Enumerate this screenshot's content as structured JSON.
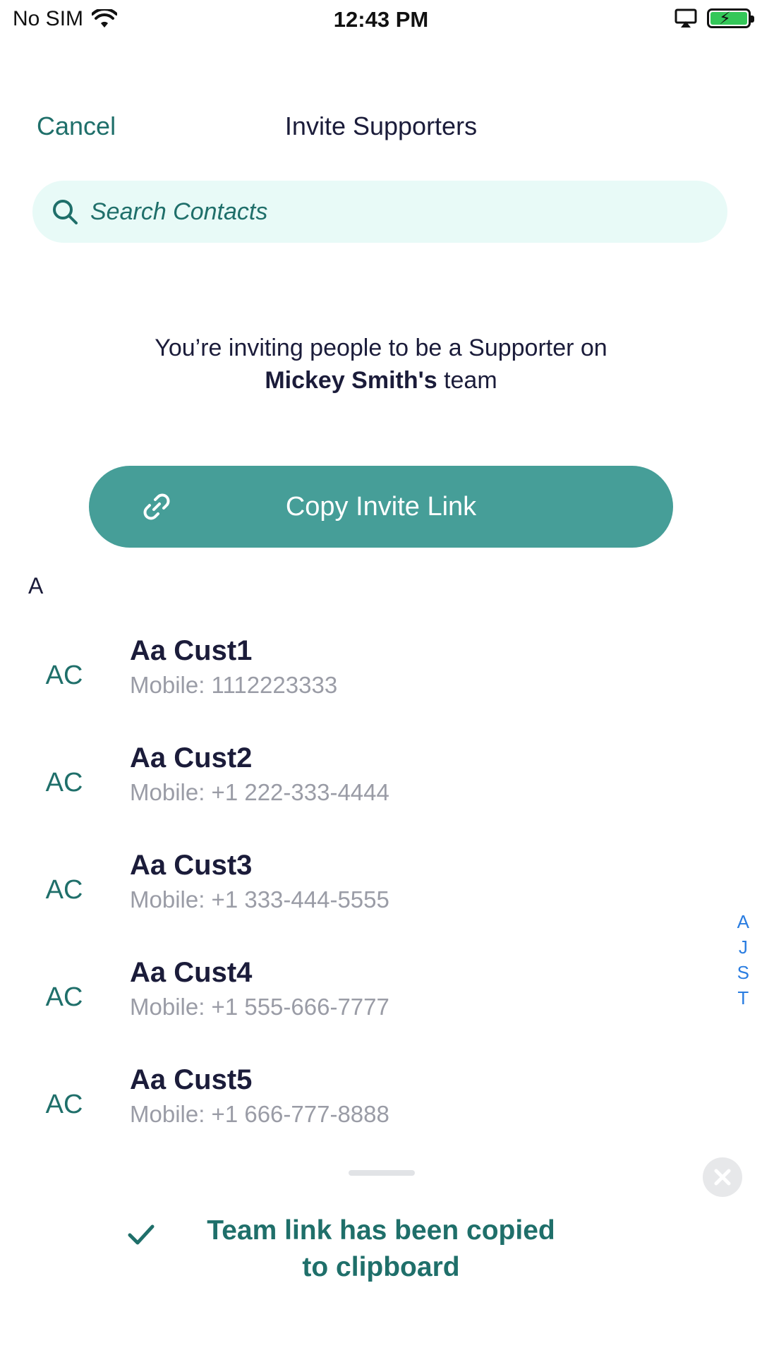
{
  "status_bar": {
    "carrier": "No SIM",
    "time": "12:43 PM",
    "icons": [
      "wifi-icon",
      "airplay-icon",
      "battery-charging-icon"
    ]
  },
  "nav": {
    "cancel_label": "Cancel",
    "title": "Invite Supporters"
  },
  "search": {
    "placeholder": "Search Contacts",
    "value": ""
  },
  "info": {
    "line1": "You’re inviting people to be a Supporter on",
    "name": "Mickey Smith's",
    "suffix": " team"
  },
  "copy_button": {
    "label": "Copy Invite Link",
    "icon": "link-icon"
  },
  "section": {
    "letter": "A"
  },
  "contacts": [
    {
      "initials": "AC",
      "name": "Aa Cust1",
      "phone": "Mobile: 1112223333"
    },
    {
      "initials": "AC",
      "name": "Aa Cust2",
      "phone": "Mobile: +1 222-333-4444"
    },
    {
      "initials": "AC",
      "name": "Aa Cust3",
      "phone": "Mobile: +1 333-444-5555"
    },
    {
      "initials": "AC",
      "name": "Aa Cust4",
      "phone": "Mobile: +1 555-666-7777"
    },
    {
      "initials": "AC",
      "name": "Aa Cust5",
      "phone": "Mobile: +1 666-777-8888"
    }
  ],
  "index_letters": [
    "A",
    "J",
    "S",
    "T"
  ],
  "toast": {
    "line1": "Team link has been copied",
    "line2": "to clipboard",
    "icons": [
      "check-icon",
      "close-icon"
    ]
  },
  "colors": {
    "accent": "#1f6f6a",
    "button": "#469e98",
    "search_bg": "#e8faf7",
    "text": "#1b1c3a",
    "muted": "#9a9ca6",
    "index": "#2a7de1"
  }
}
